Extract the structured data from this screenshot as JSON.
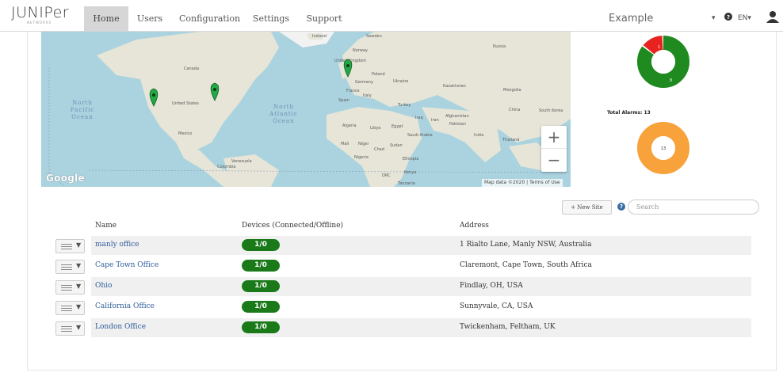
{
  "header": {
    "logo_text": "JUNIPer",
    "logo_sub": "NETWORKS",
    "tabs": [
      {
        "label": "Home",
        "active": true
      },
      {
        "label": "Users",
        "active": false
      },
      {
        "label": "Configuration",
        "active": false
      },
      {
        "label": "Settings",
        "active": false
      },
      {
        "label": "Support",
        "active": false
      }
    ],
    "org_name": "Example",
    "org_caret": "▾",
    "help_icon": "question-circle-icon",
    "language": "EN",
    "language_caret": "▾",
    "user_icon": "user-icon"
  },
  "map": {
    "labels": {
      "north_pacific": [
        "North",
        "Pacific",
        "Ocean"
      ],
      "north_atlantic": [
        "North",
        "Atlantic",
        "Ocean"
      ],
      "canada": "Canada",
      "united_states": "United States",
      "mexico": "Mexico",
      "venezuela": "Venezuela",
      "colombia": "Colombia",
      "iceland": "Iceland",
      "sweden": "Sweden",
      "norway": "Norway",
      "uk": "United Kingdom",
      "poland": "Poland",
      "germany": "Germany",
      "ukraine": "Ukraine",
      "france": "France",
      "italy": "Italy",
      "spain": "Spain",
      "turkey": "Turkey",
      "russia": "Russia",
      "kazakhstan": "Kazakhstan",
      "mongolia": "Mongolia",
      "china": "China",
      "south_korea": "South Korea",
      "afghanistan": "Afghanistan",
      "pakistan": "Pakistan",
      "iraq": "Iraq",
      "iran": "Iran",
      "india": "India",
      "thailand": "Thailand",
      "algeria": "Algeria",
      "libya": "Libya",
      "egypt": "Egypt",
      "saudi_arabia": "Saudi Arabia",
      "mali": "Mali",
      "niger": "Niger",
      "chad": "Chad",
      "sudan": "Sudan",
      "nigeria": "Nigeria",
      "ethiopia": "Ethiopia",
      "drc": "DRC",
      "kenya": "Kenya",
      "tanzania": "Tanzania"
    },
    "zoom_in": "+",
    "zoom_out": "−",
    "credit": "Map data ©2020",
    "terms": "Terms of Use",
    "google": "Google",
    "pin_color": "#22a844"
  },
  "alarms": {
    "top_donut": {
      "red_value": "1",
      "green_value": "8",
      "red_color": "#e8231f",
      "green_color": "#1f8a1f"
    },
    "total_label": "Total Alarms: 13",
    "bottom_donut": {
      "value": "13",
      "color": "#f7a23a"
    }
  },
  "toolbar": {
    "new_site_label": "+ New Site",
    "help_label": "?",
    "search_placeholder": "Search"
  },
  "table": {
    "headers": {
      "name": "Name",
      "devices": "Devices (Connected/Offline)",
      "address": "Address"
    },
    "rows": [
      {
        "name": "manly office",
        "devices": "1/0",
        "address": "1 Rialto Lane, Manly NSW, Australia"
      },
      {
        "name": "Cape Town Office",
        "devices": "1/0",
        "address": "Claremont, Cape Town, South Africa"
      },
      {
        "name": "Ohio",
        "devices": "1/0",
        "address": "Findlay, OH, USA"
      },
      {
        "name": "California Office",
        "devices": "1/0",
        "address": "Sunnyvale, CA, USA"
      },
      {
        "name": "London Office",
        "devices": "1/0",
        "address": "Twickenham, Feltham, UK"
      }
    ]
  }
}
